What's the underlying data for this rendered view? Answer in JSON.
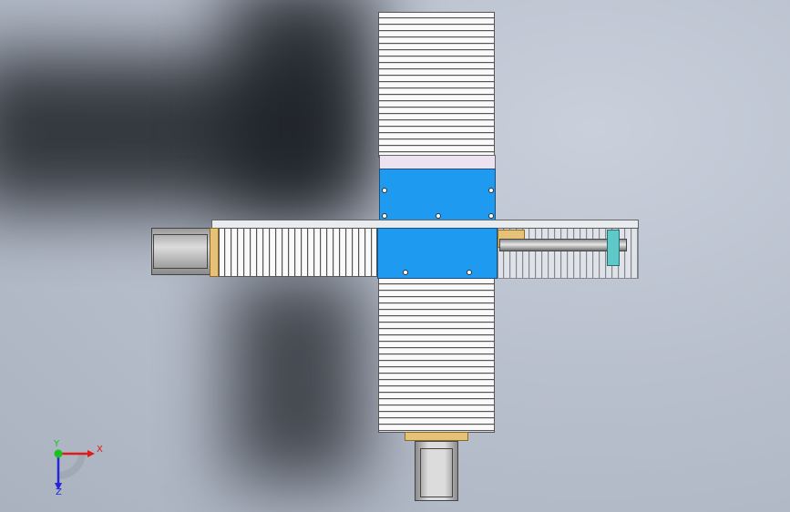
{
  "view": {
    "axis_triad": {
      "x_label": "X",
      "y_label": "Y",
      "z_label": "Z",
      "x_color": "#e01919",
      "y_color": "#19c21c",
      "z_color": "#2424d8"
    },
    "model_colors": {
      "carriage": "#1e9bf0",
      "bellows": "#f2f2f2",
      "coupling": "#e6c178",
      "background": "#b9c0cd"
    }
  }
}
